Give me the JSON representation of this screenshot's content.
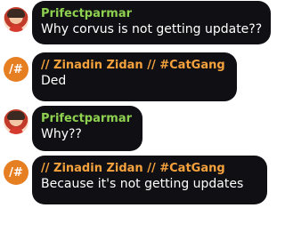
{
  "chat": {
    "messages": [
      {
        "sender": "Prifectparmar",
        "text": "Why corvus is not getting update??",
        "name_color": "#8ed04f",
        "avatar": "user-photo"
      },
      {
        "sender": "// Zinadin Zidan // #CatGang",
        "text": "Ded",
        "name_color": "#f5a23d",
        "avatar": "/#"
      },
      {
        "sender": "Prifectparmar",
        "text": "Why??",
        "name_color": "#8ed04f",
        "avatar": "user-photo"
      },
      {
        "sender": "// Zinadin Zidan // #CatGang",
        "text": "Because it's not getting updates",
        "name_color": "#f5a23d",
        "avatar": "/#"
      }
    ]
  },
  "colors": {
    "bubble": "#101014",
    "hash_avatar": "#e67e22"
  }
}
